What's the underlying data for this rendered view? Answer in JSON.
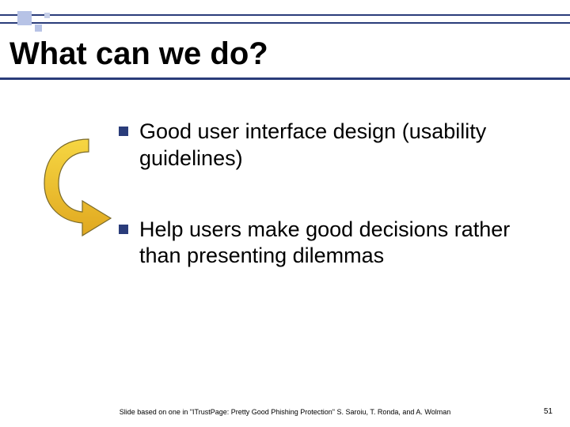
{
  "slide": {
    "title": "What can we do?",
    "bullets": [
      "Good user interface design (usability guidelines)",
      "Help users make good decisions rather than presenting dilemmas"
    ],
    "footer_citation": "Slide based on one in \"ITrustPage: Pretty Good Phishing Protection\" S. Saroiu, T. Ronda, and A. Wolman",
    "page_number": "51"
  }
}
